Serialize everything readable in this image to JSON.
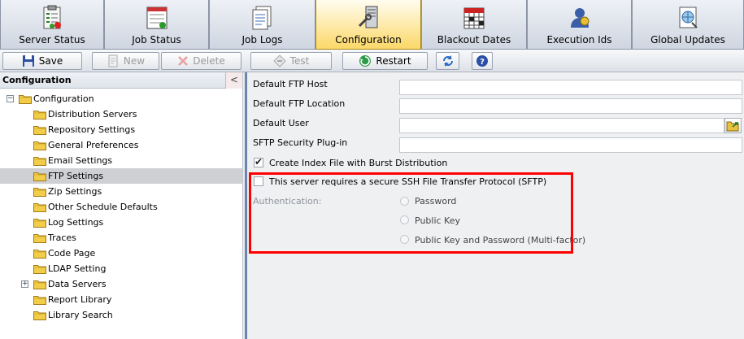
{
  "tabs": [
    {
      "label": "Server Status",
      "icon": "server-status-icon"
    },
    {
      "label": "Job Status",
      "icon": "job-status-icon"
    },
    {
      "label": "Job Logs",
      "icon": "job-logs-icon"
    },
    {
      "label": "Configuration",
      "icon": "configuration-icon",
      "active": true
    },
    {
      "label": "Blackout Dates",
      "icon": "calendar-icon"
    },
    {
      "label": "Execution Ids",
      "icon": "execution-ids-icon"
    },
    {
      "label": "Global Updates",
      "icon": "global-updates-icon"
    }
  ],
  "toolbar": {
    "save_label": "Save",
    "new_label": "New",
    "delete_label": "Delete",
    "test_label": "Test",
    "restart_label": "Restart"
  },
  "left_panel": {
    "title": "Configuration",
    "collapse_glyph": "<",
    "root_label": "Configuration",
    "items": [
      "Distribution Servers",
      "Repository Settings",
      "General Preferences",
      "Email Settings",
      "FTP Settings",
      "Zip Settings",
      "Other Schedule Defaults",
      "Log Settings",
      "Traces",
      "Code Page",
      "LDAP Setting",
      "Data Servers",
      "Report Library",
      "Library Search"
    ],
    "selected_item": "FTP Settings"
  },
  "form": {
    "ftp_host_label": "Default FTP Host",
    "ftp_host_value": "",
    "ftp_location_label": "Default FTP Location",
    "ftp_location_value": "",
    "default_user_label": "Default User",
    "default_user_value": "",
    "sftp_plugin_label": "SFTP Security Plug-in",
    "sftp_plugin_value": "",
    "create_index_label": "Create Index File with Burst Distribution",
    "create_index_checked": true,
    "secure_sftp_label": "This server requires a secure SSH File Transfer Protocol (SFTP)",
    "secure_sftp_checked": false,
    "authentication_label": "Authentication:",
    "auth_options": [
      "Password",
      "Public Key",
      "Public Key and Password (Multi-factor)"
    ]
  },
  "colors": {
    "highlight_border": "#ff0000",
    "active_tab": "#fcd868",
    "splitter": "#6e86ad"
  }
}
